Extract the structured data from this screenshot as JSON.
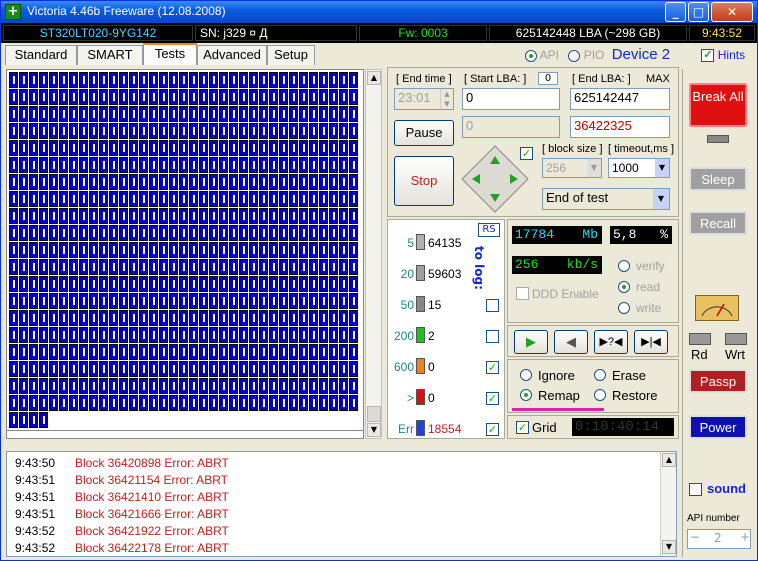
{
  "window": {
    "title": "Victoria 4.46b Freeware (12.08.2008)",
    "min_label": "_",
    "max_label": "□",
    "close_label": "✕"
  },
  "infobar": {
    "model": "ST320LT020-9YG142",
    "serial": "SN: j329      ¤ Д",
    "firmware": "Fw: 0003",
    "capacity": "625142448 LBA (~298 GB)",
    "clock": "9:43:52"
  },
  "tabs": [
    "Standard",
    "SMART",
    "Tests",
    "Advanced",
    "Setup"
  ],
  "mode": {
    "api_label": "API",
    "pio_label": "PIO",
    "device_label": "Device 2",
    "hints_label": "Hints"
  },
  "controls": {
    "end_time_label": "[ End time ]",
    "end_time_value": "23:01",
    "start_lba_label": "[ Start LBA: ]",
    "start_lba_zero": "0",
    "start_lba_value": "0",
    "current_lba_value": "0",
    "end_lba_label": "[ End LBA: ]",
    "end_lba_max": "MAX",
    "end_lba_value": "625142447",
    "position_value": "36422325",
    "pause_label": "Pause",
    "stop_label": "Stop",
    "block_size_label": "[ block size ]",
    "block_size_value": "256",
    "timeout_label": "[ timeout,ms ]",
    "timeout_value": "1000",
    "end_action_value": "End of test"
  },
  "stats": {
    "rs_label": "RS",
    "to_log_label": "to log:",
    "rows": [
      {
        "threshold": "5",
        "count": "64135",
        "color": "#b0b0b0"
      },
      {
        "threshold": "20",
        "count": "59603",
        "color": "#a0a0a0"
      },
      {
        "threshold": "50",
        "count": "15",
        "color": "#888888"
      },
      {
        "threshold": "200",
        "count": "2",
        "color": "#21c021"
      },
      {
        "threshold": "600",
        "count": "0",
        "color": "#f08020"
      },
      {
        "threshold": ">",
        "count": "0",
        "color": "#e01010"
      },
      {
        "threshold": "Err",
        "count": "18554",
        "color": "#2040e0"
      }
    ]
  },
  "readouts": {
    "mb_value": "17784",
    "mb_unit": "Mb",
    "percent_value": "5,8",
    "percent_unit": "%",
    "speed_value": "256",
    "speed_unit": "kb/s",
    "ddd_label": "DDD Enable",
    "verify_label": "verify",
    "read_label": "read",
    "write_label": "write"
  },
  "actions": {
    "ignore_label": "Ignore",
    "erase_label": "Erase",
    "remap_label": "Remap",
    "restore_label": "Restore",
    "grid_label": "Grid",
    "timer_value": "0:10:40:14"
  },
  "right": {
    "break_label": "Break All",
    "sleep_label": "Sleep",
    "recall_label": "Recall",
    "rd_label": "Rd",
    "wrt_label": "Wrt",
    "passp_label": "Passp",
    "power_label": "Power",
    "sound_label": "sound",
    "api_number_label": "API number",
    "api_number_value": "2",
    "minus_label": "−",
    "plus_label": "+"
  },
  "log": [
    {
      "time": "9:43:50",
      "msg": "Block 36420898 Error: ABRT"
    },
    {
      "time": "9:43:51",
      "msg": "Block 36421154 Error: ABRT"
    },
    {
      "time": "9:43:51",
      "msg": "Block 36421410 Error: ABRT"
    },
    {
      "time": "9:43:51",
      "msg": "Block 36421666 Error: ABRT"
    },
    {
      "time": "9:43:52",
      "msg": "Block 36421922 Error: ABRT"
    },
    {
      "time": "9:43:52",
      "msg": "Block 36422178 Error: ABRT"
    }
  ]
}
